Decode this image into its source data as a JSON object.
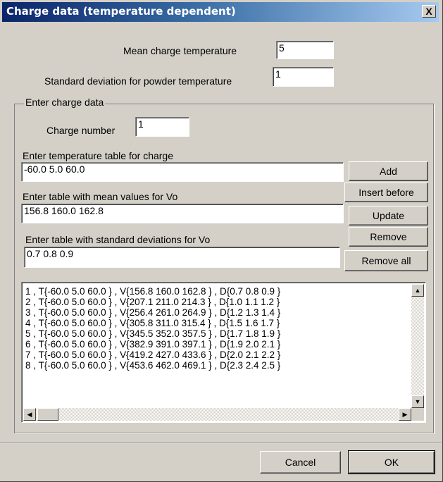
{
  "window": {
    "title": "Charge data (temperature dependent)",
    "close_glyph": "X"
  },
  "mean_temp": {
    "label": "Mean charge temperature",
    "value": "5"
  },
  "std_temp": {
    "label": "Standard deviation for powder temperature",
    "value": "1"
  },
  "group": {
    "title": "Enter charge data",
    "charge_number": {
      "label": "Charge number",
      "value": "1"
    },
    "temp_table": {
      "label": "Enter temperature table for charge",
      "value": "-60.0 5.0 60.0"
    },
    "mean_table": {
      "label": "Enter table with mean values for Vo",
      "value": "156.8 160.0 162.8"
    },
    "std_table": {
      "label": "Enter table with standard deviations for Vo",
      "value": "0.7 0.8 0.9"
    },
    "buttons": {
      "add": "Add",
      "insert_before": "Insert before",
      "update": "Update",
      "remove": "Remove",
      "remove_all": "Remove all"
    },
    "list": [
      "1 , T{-60.0 5.0 60.0 } , V{156.8 160.0 162.8 } , D{0.7 0.8 0.9 }",
      "2 , T{-60.0 5.0 60.0 } , V{207.1 211.0 214.3 } , D{1.0 1.1 1.2 }",
      "3 , T{-60.0 5.0 60.0 } , V{256.4 261.0 264.9 } , D{1.2 1.3 1.4 }",
      "4 , T{-60.0 5.0 60.0 } , V{305.8 311.0 315.4 } , D{1.5 1.6 1.7 }",
      "5 , T{-60.0 5.0 60.0 } , V{345.5 352.0 357.5 } , D{1.7 1.8 1.9 }",
      "6 , T{-60.0 5.0 60.0 } , V{382.9 391.0 397.1 } , D{1.9 2.0 2.1 }",
      "7 , T{-60.0 5.0 60.0 } , V{419.2 427.0 433.6 } , D{2.0 2.1 2.2 }",
      "8 , T{-60.0 5.0 60.0 } , V{453.6 462.0 469.1 } , D{2.3 2.4 2.5 }"
    ]
  },
  "footer": {
    "cancel": "Cancel",
    "ok": "OK"
  },
  "icons": {
    "scroll_up": "scroll-up-arrow-icon",
    "scroll_down": "scroll-down-arrow-icon",
    "scroll_left": "scroll-left-arrow-icon",
    "scroll_right": "scroll-right-arrow-icon"
  }
}
